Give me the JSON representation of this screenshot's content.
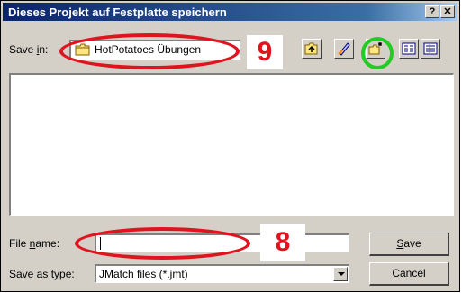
{
  "window": {
    "title": "Dieses Projekt auf Festplatte speichern",
    "help_glyph": "?",
    "close_glyph": "✕"
  },
  "location": {
    "label_prefix": "Save ",
    "label_accel": "i",
    "label_suffix": "n:",
    "current_folder": "HotPotatoes Übungen"
  },
  "toolbar": {
    "icons": [
      "up-one-level-icon",
      "desktop-icon",
      "new-folder-icon",
      "list-view-icon",
      "details-view-icon"
    ]
  },
  "file_name": {
    "label_prefix": "File ",
    "label_accel": "n",
    "label_suffix": "ame:",
    "value": ""
  },
  "file_type": {
    "label_prefix": "Save as ",
    "label_accel": "t",
    "label_suffix": "ype:",
    "value": "JMatch files (*.jmt)"
  },
  "buttons": {
    "save_accel": "S",
    "save_rest": "ave",
    "cancel": "Cancel"
  },
  "annotations": {
    "step_location": "9",
    "step_filename": "8",
    "highlight_color": "#e0141e",
    "new_folder_highlight_color": "#22cc22"
  }
}
